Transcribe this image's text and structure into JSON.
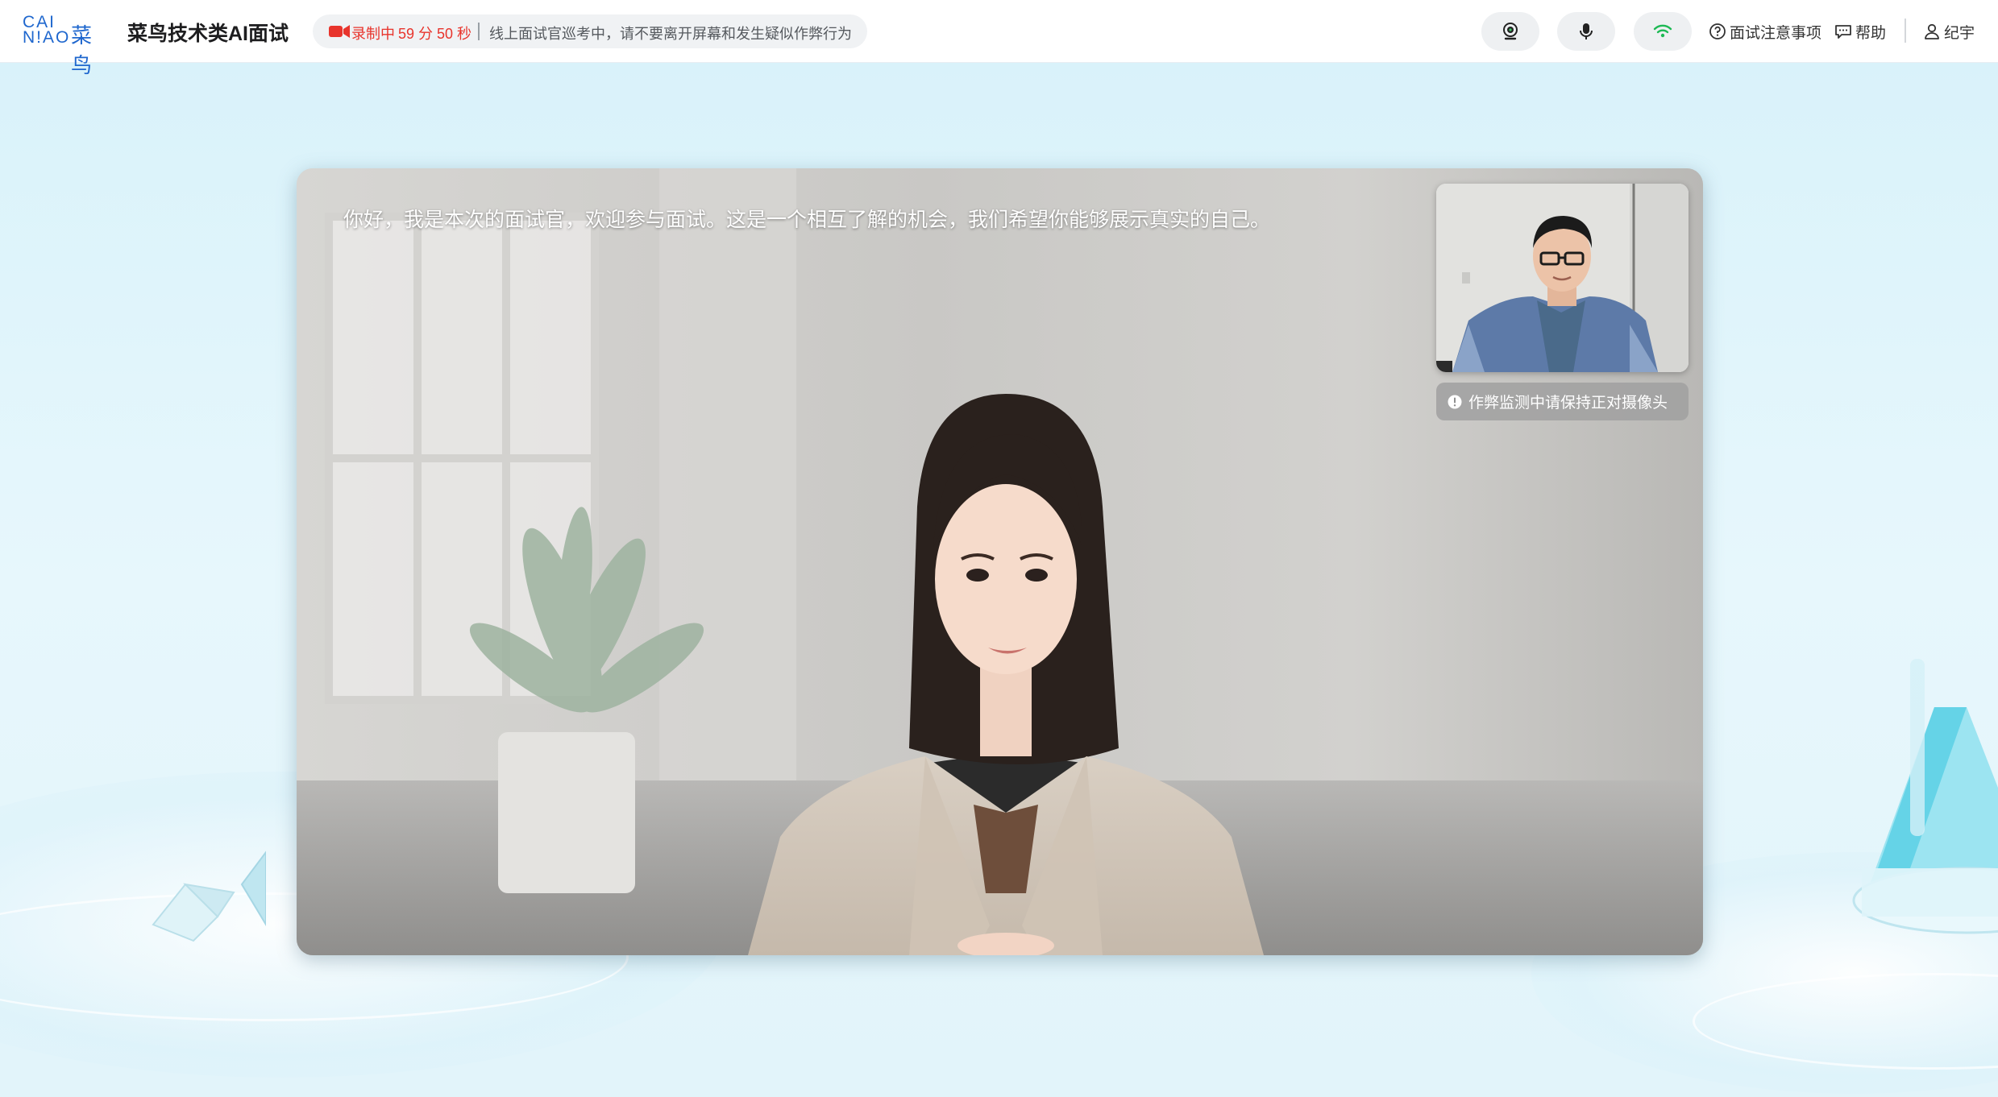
{
  "header": {
    "logo_latin": "CAI N!AO",
    "logo_cn": "菜鸟",
    "app_title": "菜鸟技术类AI面试",
    "recording": {
      "status": "录制中",
      "time": "59 分 50 秒",
      "notice": "线上面试官巡考中，请不要离开屏幕和发生疑似作弊行为"
    },
    "controls": {
      "camera_icon": "webcam-icon",
      "mic_icon": "microphone-icon",
      "network_icon": "wifi-icon"
    },
    "links": {
      "notice": "面试注意事项",
      "help": "帮助",
      "user": "纪宇"
    }
  },
  "video": {
    "subtitle": "你好，我是本次的面试官，欢迎参与面试。这是一个相互了解的机会，我们希望你能够展示真实的自己。",
    "pip_notice": "作弊监测中请保持正对摄像头"
  },
  "colors": {
    "brand": "#1f67ce",
    "recording": "#e8342c",
    "network": "#1db954"
  }
}
